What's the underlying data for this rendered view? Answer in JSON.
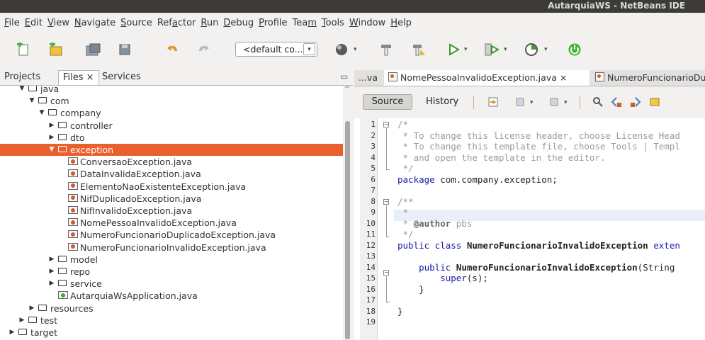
{
  "window": {
    "title": "AutarquiaWS - NetBeans IDE"
  },
  "menu": [
    {
      "pre": "",
      "u": "F",
      "post": "ile"
    },
    {
      "pre": "",
      "u": "E",
      "post": "dit"
    },
    {
      "pre": "",
      "u": "V",
      "post": "iew"
    },
    {
      "pre": "",
      "u": "N",
      "post": "avigate"
    },
    {
      "pre": "",
      "u": "S",
      "post": "ource"
    },
    {
      "pre": "Ref",
      "u": "a",
      "post": "ctor"
    },
    {
      "pre": "",
      "u": "R",
      "post": "un"
    },
    {
      "pre": "",
      "u": "D",
      "post": "ebug"
    },
    {
      "pre": "",
      "u": "P",
      "post": "rofile"
    },
    {
      "pre": "Tea",
      "u": "m",
      "post": ""
    },
    {
      "pre": "",
      "u": "T",
      "post": "ools"
    },
    {
      "pre": "",
      "u": "W",
      "post": "indow"
    },
    {
      "pre": "",
      "u": "H",
      "post": "elp"
    }
  ],
  "toolbar": {
    "config_combo": "<default co..."
  },
  "left_tabs": {
    "projects": "Projects",
    "files": "Files",
    "services": "Services"
  },
  "tree": [
    {
      "label": "java",
      "depth": 2,
      "type": "folder",
      "open": true
    },
    {
      "label": "com",
      "depth": 3,
      "type": "folder",
      "open": true
    },
    {
      "label": "company",
      "depth": 4,
      "type": "folder",
      "open": true
    },
    {
      "label": "controller",
      "depth": 5,
      "type": "folder",
      "open": false
    },
    {
      "label": "dto",
      "depth": 5,
      "type": "folder",
      "open": false
    },
    {
      "label": "exception",
      "depth": 5,
      "type": "folder",
      "open": true,
      "selected": true
    },
    {
      "label": "ConversaoException.java",
      "depth": 6,
      "type": "java"
    },
    {
      "label": "DataInvalidaException.java",
      "depth": 6,
      "type": "java"
    },
    {
      "label": "ElementoNaoExistenteException.java",
      "depth": 6,
      "type": "java"
    },
    {
      "label": "NifDuplicadoException.java",
      "depth": 6,
      "type": "java"
    },
    {
      "label": "NifInvalidoException.java",
      "depth": 6,
      "type": "java"
    },
    {
      "label": "NomePessoaInvalidoException.java",
      "depth": 6,
      "type": "java"
    },
    {
      "label": "NumeroFuncionarioDuplicadoException.java",
      "depth": 6,
      "type": "java"
    },
    {
      "label": "NumeroFuncionarioInvalidoException.java",
      "depth": 6,
      "type": "java"
    },
    {
      "label": "model",
      "depth": 5,
      "type": "folder",
      "open": false
    },
    {
      "label": "repo",
      "depth": 5,
      "type": "folder",
      "open": false
    },
    {
      "label": "service",
      "depth": 5,
      "type": "folder",
      "open": false
    },
    {
      "label": "AutarquiaWsApplication.java",
      "depth": 5,
      "type": "app"
    },
    {
      "label": "resources",
      "depth": 3,
      "type": "folder",
      "open": false
    },
    {
      "label": "test",
      "depth": 2,
      "type": "folder",
      "open": false
    },
    {
      "label": "target",
      "depth": 1,
      "type": "folder",
      "open": false
    }
  ],
  "editor_tabs": [
    {
      "label": "...va",
      "icon": false
    },
    {
      "label": "NomePessoaInvalidoException.java",
      "icon": true,
      "close": "×",
      "active": true
    },
    {
      "label": "NumeroFuncionarioDuplica",
      "icon": true
    }
  ],
  "editor_toolbar": {
    "source": "Source",
    "history": "History"
  },
  "line_numbers": [
    "1",
    "2",
    "3",
    "4",
    "5",
    "6",
    "7",
    "8",
    "9",
    "10",
    "11",
    "12",
    "13",
    "14",
    "15",
    "16",
    "17",
    "18",
    "19"
  ],
  "code": {
    "l1": "/*",
    "l2": " * To change this license header, choose License Head",
    "l3": " * To change this template file, choose Tools | Templ",
    "l4": " * and open the template in the editor.",
    "l5": " */",
    "l6_kw": "package",
    "l6_rest": " com.company.exception;",
    "l8": "/**",
    "l9": " *",
    "l10_pre": " * ",
    "l10_tag": "@author",
    "l10_val": " pbs",
    "l11": " */",
    "l12_kw": "public class",
    "l12_name": " NumeroFuncionarioInvalidoException",
    "l12_ext": " exten",
    "l14_kw": "    public",
    "l14_name": " NumeroFuncionarioInvalidoException",
    "l14_rest": "(String",
    "l15_kw": "        super",
    "l15_rest": "(s);",
    "l16": "    }",
    "l18": "}"
  }
}
